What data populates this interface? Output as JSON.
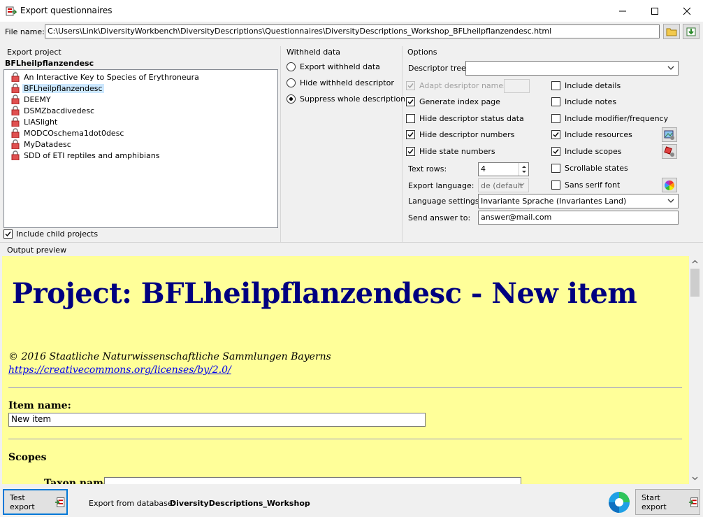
{
  "window": {
    "title": "Export questionnaires"
  },
  "file": {
    "label": "File name:",
    "value": "C:\\Users\\Link\\DiversityWorkbench\\DiversityDescriptions\\Questionnaires\\DiversityDescriptions_Workshop_BFLheilpflanzendesc.html"
  },
  "export_project": {
    "label": "Export project",
    "selected_title": "BFLheilpflanzendesc",
    "items": [
      "An Interactive Key to Species of Erythroneura",
      "BFLheilpflanzendesc",
      "DEEMY",
      "DSMZbacdivedesc",
      "LIASlight",
      "MODCOschema1dot0desc",
      "MyDatadesc",
      "SDD of ETI reptiles and amphibians"
    ],
    "include_child_label": "Include child projects"
  },
  "withheld": {
    "label": "Withheld data",
    "options": [
      "Export withheld data",
      "Hide withheld descriptor",
      "Suppress whole description"
    ]
  },
  "options": {
    "label": "Options",
    "descriptor_tree_label": "Descriptor tree:",
    "descriptor_tree_value": "",
    "left": [
      "Adapt desriptor names",
      "Generate index page",
      "Hide descriptor status data",
      "Hide descriptor numbers",
      "Hide state numbers"
    ],
    "right": [
      "Include details",
      "Include notes",
      "Include modifier/frequency",
      "Include resources",
      "Include scopes",
      "Scrollable states",
      "Sans serif font"
    ],
    "text_rows_label": "Text rows:",
    "text_rows_value": "4",
    "export_language_label": "Export language:",
    "export_language_value": "de (default",
    "language_settings_label": "Language settings:",
    "language_settings_value": "Invariante Sprache (Invariantes Land)",
    "send_answer_label": "Send answer to:",
    "send_answer_value": "answer@mail.com"
  },
  "preview": {
    "label": "Output preview",
    "heading": "Project: BFLheilpflanzendesc - New item",
    "copyright": "© 2016 Staatliche Naturwissenschaftliche Sammlungen Bayerns",
    "license_link": "https://creativecommons.org/licenses/by/2.0/",
    "item_name_label": "Item name:",
    "item_name_value": "New item",
    "scopes_heading": "Scopes",
    "taxon_name_label": "Taxon name:"
  },
  "footer": {
    "test_export": "Test export",
    "export_from_label": "Export from database:",
    "database_name": "DiversityDescriptions_Workshop",
    "start_export": "Start export"
  },
  "colors": {
    "accent": "#0078d7",
    "preview_bg": "#ffff99",
    "heading": "#000080",
    "selection": "#cce8ff"
  }
}
